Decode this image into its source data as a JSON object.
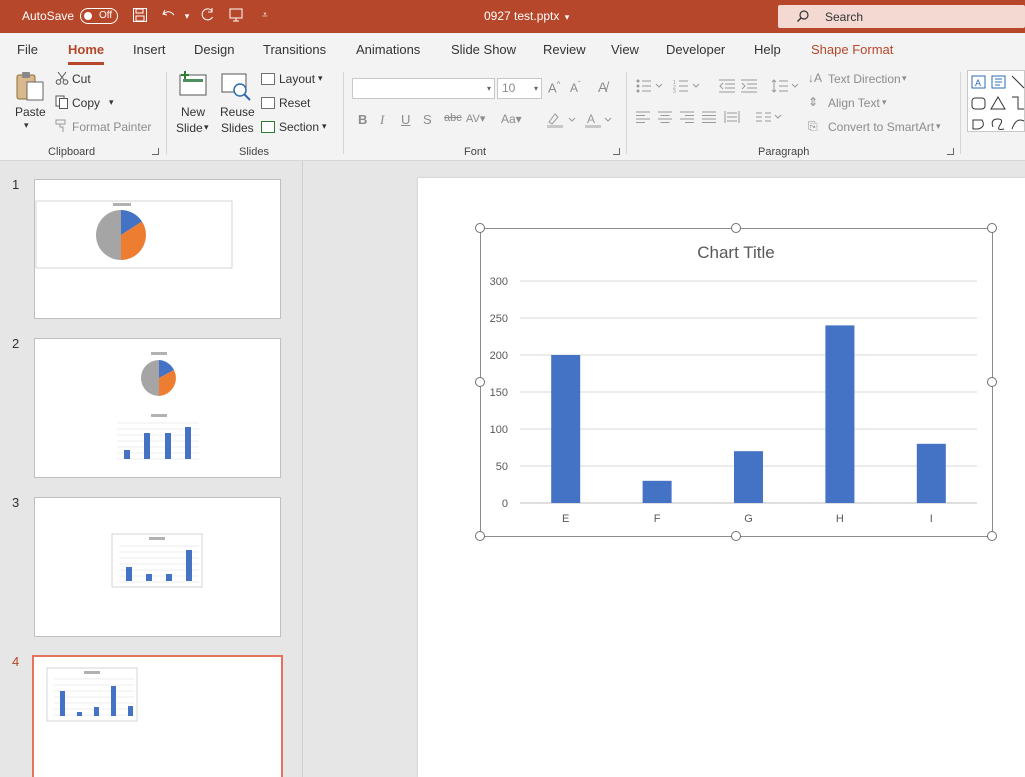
{
  "titlebar": {
    "autosave_label": "AutoSave",
    "autosave_state": "Off",
    "document_title": "0927 test.pptx",
    "search_placeholder": "Search"
  },
  "menu": {
    "tabs": [
      "File",
      "Home",
      "Insert",
      "Design",
      "Transitions",
      "Animations",
      "Slide Show",
      "Review",
      "View",
      "Developer",
      "Help",
      "Shape Format"
    ],
    "active": "Home"
  },
  "ribbon": {
    "clipboard": {
      "paste": "Paste",
      "cut": "Cut",
      "copy": "Copy",
      "format_painter": "Format Painter",
      "label": "Clipboard"
    },
    "slides": {
      "new_slide_1": "New",
      "new_slide_2": "Slide",
      "reuse_1": "Reuse",
      "reuse_2": "Slides",
      "layout": "Layout",
      "reset": "Reset",
      "section": "Section",
      "label": "Slides"
    },
    "font": {
      "font_name": "",
      "font_size": "10",
      "label": "Font"
    },
    "paragraph": {
      "text_direction": "Text Direction",
      "align_text": "Align Text",
      "convert_smartart": "Convert to SmartArt",
      "label": "Paragraph"
    }
  },
  "thumbnails": [
    {
      "number": "1",
      "selected": false
    },
    {
      "number": "2",
      "selected": false
    },
    {
      "number": "3",
      "selected": false
    },
    {
      "number": "4",
      "selected": true
    }
  ],
  "chart_data": {
    "type": "bar",
    "title": "Chart Title",
    "categories": [
      "E",
      "F",
      "G",
      "H",
      "I"
    ],
    "values": [
      200,
      30,
      70,
      240,
      80
    ],
    "ylim": [
      0,
      300
    ],
    "yticks": [
      0,
      50,
      100,
      150,
      200,
      250,
      300
    ],
    "grid": true,
    "legend": "none",
    "bar_color": "#4472c4"
  },
  "colors": {
    "accent": "#b7472a",
    "selection": "#e5735b"
  }
}
